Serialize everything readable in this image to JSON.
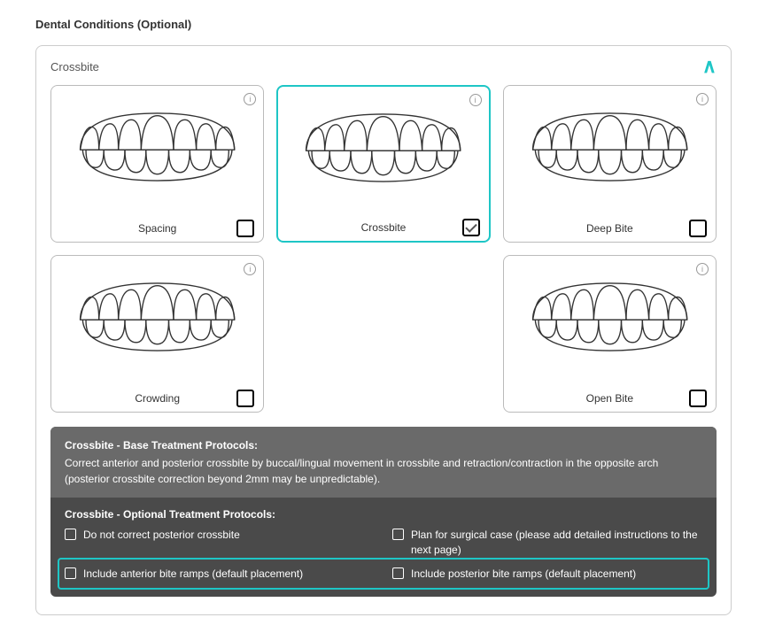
{
  "section_title": "Dental Conditions (Optional)",
  "panel_title": "Crossbite",
  "cards": [
    {
      "label": "Spacing",
      "checked": false,
      "selected": false
    },
    {
      "label": "Crossbite",
      "checked": true,
      "selected": true
    },
    {
      "label": "Deep Bite",
      "checked": false,
      "selected": false
    },
    {
      "label": "Crowding",
      "checked": false,
      "selected": false
    },
    {
      "label": "",
      "checked": false,
      "selected": false,
      "placeholder": true
    },
    {
      "label": "Open Bite",
      "checked": false,
      "selected": false
    }
  ],
  "protocols": {
    "base_title": "Crossbite - Base Treatment Protocols:",
    "base_text": "Correct anterior and posterior crossbite by buccal/lingual movement in crossbite and retraction/contraction in the opposite arch (posterior crossbite correction beyond 2mm may be unpredictable).",
    "optional_title": "Crossbite - Optional Treatment Protocols:",
    "options": [
      {
        "label": "Do not correct posterior crossbite",
        "checked": false
      },
      {
        "label": "Plan for surgical case (please add detailed instructions to the next page)",
        "checked": false
      },
      {
        "label": "Include anterior bite ramps (default placement)",
        "checked": false
      },
      {
        "label": "Include posterior bite ramps (default placement)",
        "checked": false
      }
    ]
  }
}
